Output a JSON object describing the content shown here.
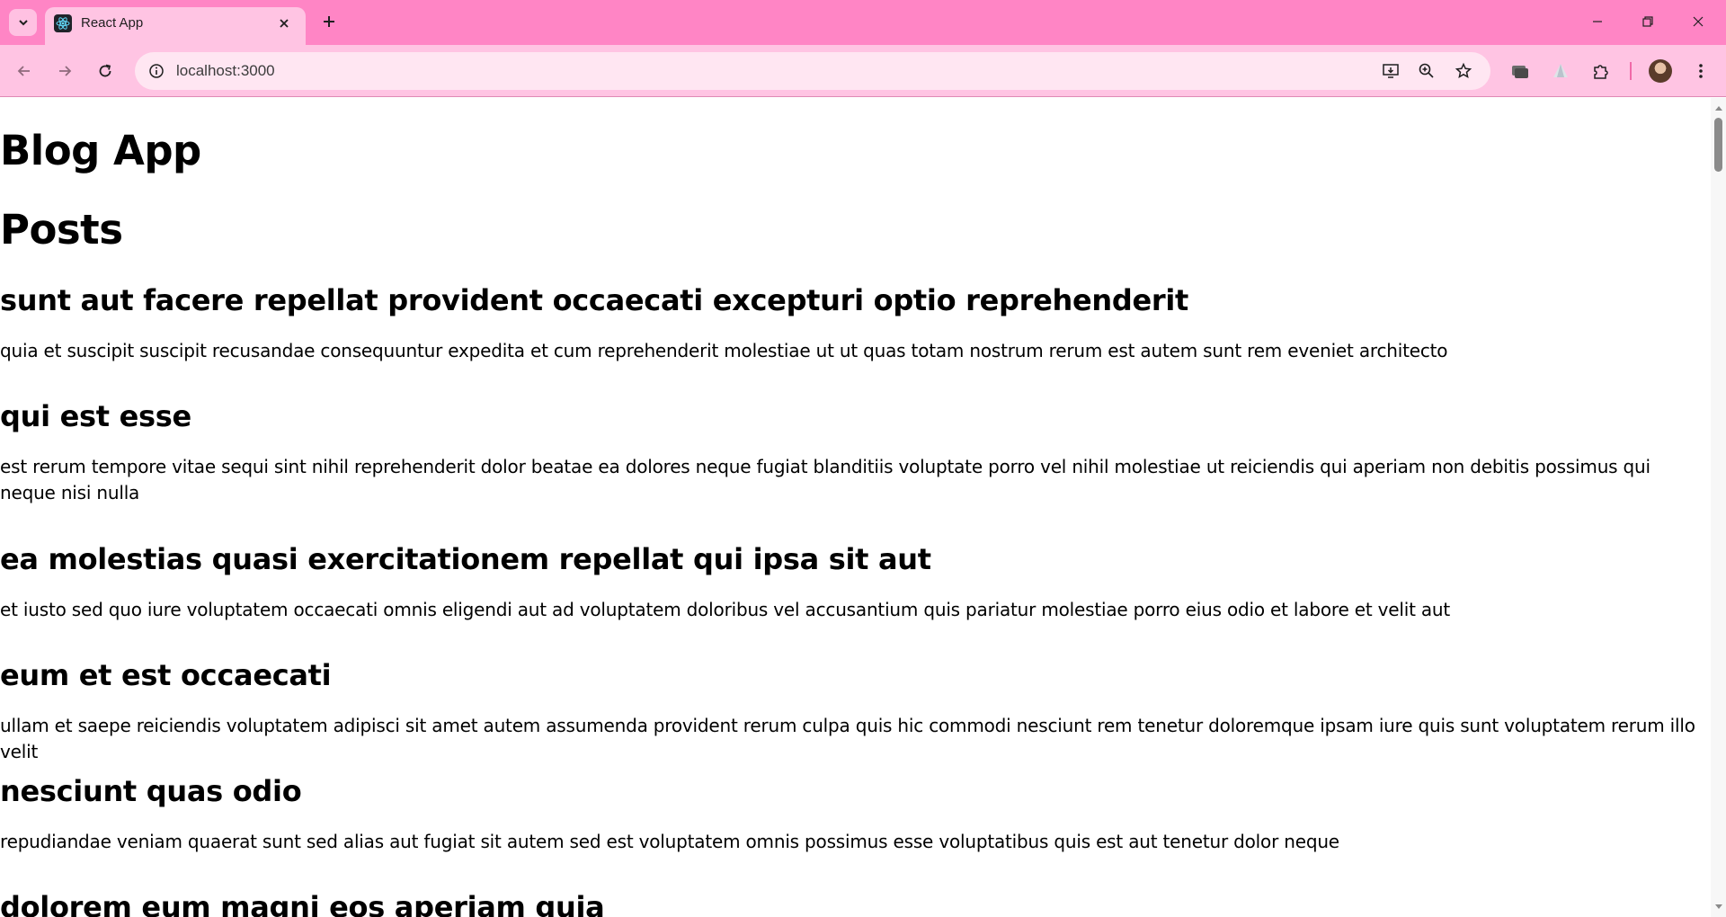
{
  "browser": {
    "tab_title": "React App",
    "url": "localhost:3000",
    "icons": {
      "tab_search": "chevron-down-icon",
      "favicon": "react-logo-icon",
      "tab_close": "close-icon",
      "new_tab": "plus-icon",
      "back": "arrow-left-icon",
      "forward": "arrow-right-icon",
      "reload": "reload-icon",
      "site_info": "info-icon",
      "install": "install-app-icon",
      "zoom": "zoom-icon",
      "bookmark": "star-icon",
      "extensions": "puzzle-icon",
      "menu": "kebab-menu-icon"
    },
    "colors": {
      "tabbar": "#ff85c5",
      "toolbar": "#ffc4e3",
      "omnibox": "#ffe6f2"
    }
  },
  "page": {
    "app_title": "Blog App",
    "posts_heading": "Posts",
    "posts": [
      {
        "title": "sunt aut facere repellat provident occaecati excepturi optio reprehenderit",
        "body": "quia et suscipit suscipit recusandae consequuntur expedita et cum reprehenderit molestiae ut ut quas totam nostrum rerum est autem sunt rem eveniet architecto"
      },
      {
        "title": "qui est esse",
        "body": "est rerum tempore vitae sequi sint nihil reprehenderit dolor beatae ea dolores neque fugiat blanditiis voluptate porro vel nihil molestiae ut reiciendis qui aperiam non debitis possimus qui neque nisi nulla"
      },
      {
        "title": "ea molestias quasi exercitationem repellat qui ipsa sit aut",
        "body": "et iusto sed quo iure voluptatem occaecati omnis eligendi aut ad voluptatem doloribus vel accusantium quis pariatur molestiae porro eius odio et labore et velit aut"
      },
      {
        "title": "eum et est occaecati",
        "body": "ullam et saepe reiciendis voluptatem adipisci sit amet autem assumenda provident rerum culpa quis hic commodi nesciunt rem tenetur doloremque ipsam iure quis sunt voluptatem rerum illo velit"
      },
      {
        "title": "nesciunt quas odio",
        "body": "repudiandae veniam quaerat sunt sed alias aut fugiat sit autem sed est voluptatem omnis possimus esse voluptatibus quis est aut tenetur dolor neque"
      },
      {
        "title": "dolorem eum magni eos aperiam quia",
        "body": ""
      }
    ]
  }
}
